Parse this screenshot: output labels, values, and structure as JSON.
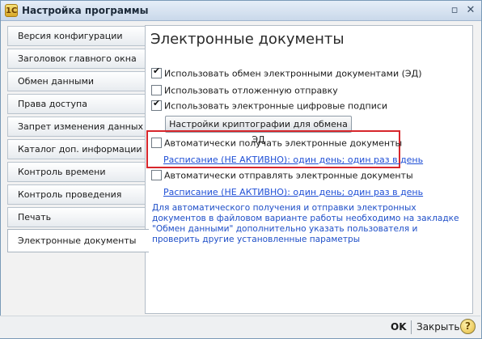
{
  "window": {
    "title": "Настройка программы",
    "app_icon_glyph": "1С"
  },
  "tabs": [
    {
      "label": "Версия конфигурации"
    },
    {
      "label": "Заголовок главного окна"
    },
    {
      "label": "Обмен данными"
    },
    {
      "label": "Права доступа"
    },
    {
      "label": "Запрет изменения данных"
    },
    {
      "label": "Каталог доп. информации"
    },
    {
      "label": "Контроль времени"
    },
    {
      "label": "Контроль проведения"
    },
    {
      "label": "Печать"
    },
    {
      "label": "Электронные документы",
      "active": true
    }
  ],
  "main": {
    "heading": "Электронные документы",
    "checkboxes": [
      {
        "label": "Использовать обмен электронными документами (ЭД)",
        "checked": true
      },
      {
        "label": "Использовать отложенную отправку",
        "checked": false
      },
      {
        "label": "Использовать электронные цифровые подписи",
        "checked": true
      },
      {
        "label": "Автоматически получать электронные документы",
        "checked": false
      },
      {
        "label": "Автоматически отправлять электронные документы",
        "checked": false
      }
    ],
    "crypto_button": "Настройки криптографии для обмена ЭД",
    "schedule_receive_link": "Расписание (НЕ АКТИВНО): один день; один раз в день",
    "schedule_send_link": "Расписание (НЕ АКТИВНО): один день; один раз в день",
    "info_text": "Для автоматического получения и отправки электронных документов в файловом варианте работы необходимо на закладке \"Обмен данными\" дополнительно указать пользователя и проверить другие установленные параметры"
  },
  "footer": {
    "ok": "OK",
    "close": "Закрыть",
    "help_glyph": "?"
  },
  "colors": {
    "highlight_frame": "#d7262b",
    "link": "#1f4fd6"
  }
}
